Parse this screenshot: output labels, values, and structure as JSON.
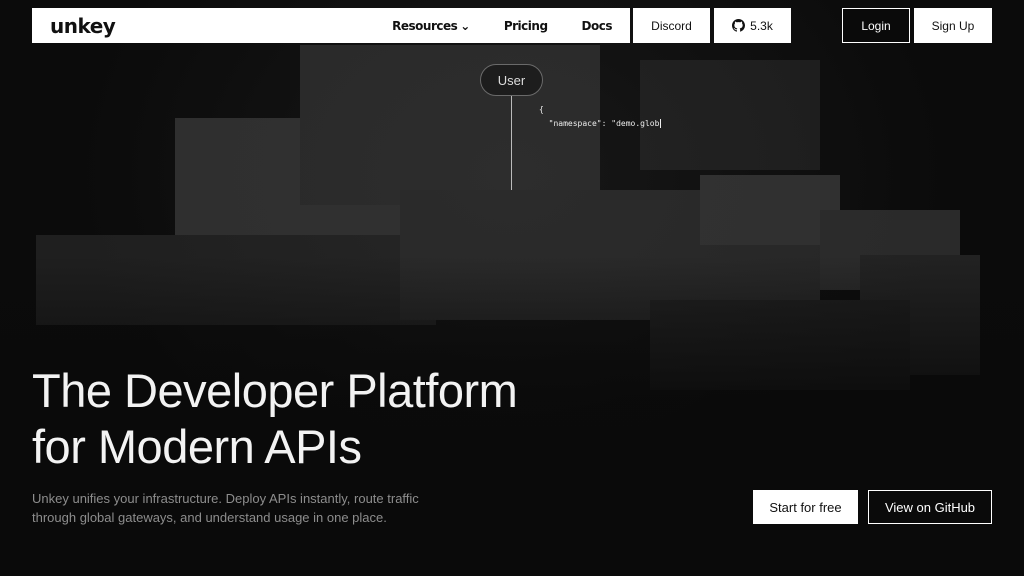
{
  "nav": {
    "logo": "unkey",
    "menu": {
      "resources": "Resources",
      "pricing": "Pricing",
      "docs": "Docs"
    },
    "discord": "Discord",
    "github_stars": "5.3k",
    "login": "Login",
    "signup": "Sign Up"
  },
  "diagram": {
    "user_label": "User",
    "code_line1": "{",
    "code_line2": "  \"namespace\": \"demo.glob"
  },
  "hero": {
    "headline_line1": "The Developer Platform",
    "headline_line2": "for Modern APIs",
    "subtext": "Unkey unifies your infrastructure. Deploy APIs instantly, route traffic through global gateways, and understand usage in one place.",
    "cta_primary": "Start for free",
    "cta_secondary": "View on GitHub"
  },
  "icons": {
    "github": "github-icon",
    "chevron": "chevron-down-icon"
  },
  "colors": {
    "background": "#0a0a0a",
    "nav_bg": "#ffffff",
    "subtext": "#8d8d8d"
  }
}
